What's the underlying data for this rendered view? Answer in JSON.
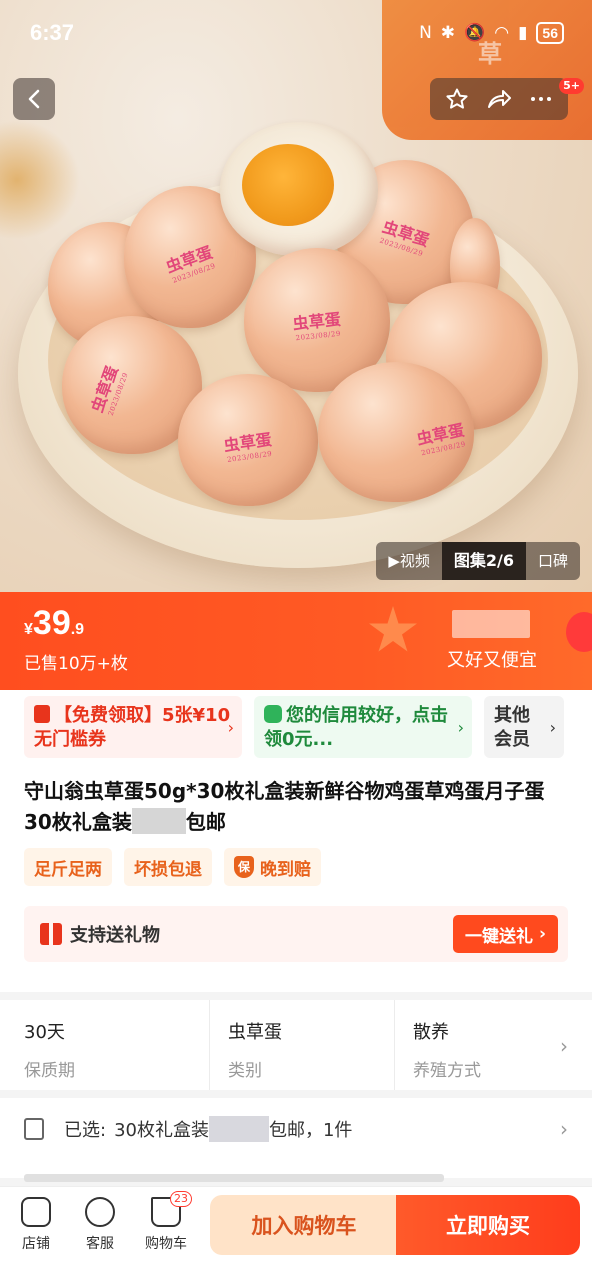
{
  "status_bar": {
    "time": "6:37",
    "battery": "56"
  },
  "nav": {
    "badge": "5+"
  },
  "hero": {
    "egg_stamp": "虫草蛋",
    "egg_date": "2023/08/29",
    "box_char": "草",
    "media_tabs": [
      {
        "label": "▶视频"
      },
      {
        "label": "图集2/6"
      },
      {
        "label": "口碑"
      }
    ]
  },
  "price": {
    "currency": "¥",
    "integer": "39",
    "decimal": ".9",
    "sold": "已售10万+枚",
    "slogan": "又好又便宜"
  },
  "coupons": [
    {
      "text": "【免费领取】5张¥10无门槛券"
    },
    {
      "text": "您的信用较好，点击领0元..."
    },
    {
      "text": "其他会员"
    }
  ],
  "product": {
    "title_part1": "守山翁虫草蛋50g*30枚礼盒装新鲜谷物鸡蛋草鸡蛋月子蛋 30枚礼盒装",
    "title_part2": "包邮",
    "tags": [
      "足斤足两",
      "坏损包退",
      "晚到赔"
    ],
    "tag_shield": "保"
  },
  "gift": {
    "label": "支持送礼物",
    "button": "一键送礼"
  },
  "specs": [
    {
      "value": "30天",
      "key": "保质期"
    },
    {
      "value": "虫草蛋",
      "key": "类别"
    },
    {
      "value": "散养",
      "key": "养殖方式"
    }
  ],
  "selected": {
    "prefix": "已选:",
    "part1": "30枚礼盒装",
    "part2": "包邮，1件"
  },
  "bottom": {
    "tools": [
      {
        "label": "店铺"
      },
      {
        "label": "客服"
      },
      {
        "label": "购物车",
        "badge": "23"
      }
    ],
    "add_to_cart": "加入购物车",
    "buy_now": "立即购买"
  }
}
